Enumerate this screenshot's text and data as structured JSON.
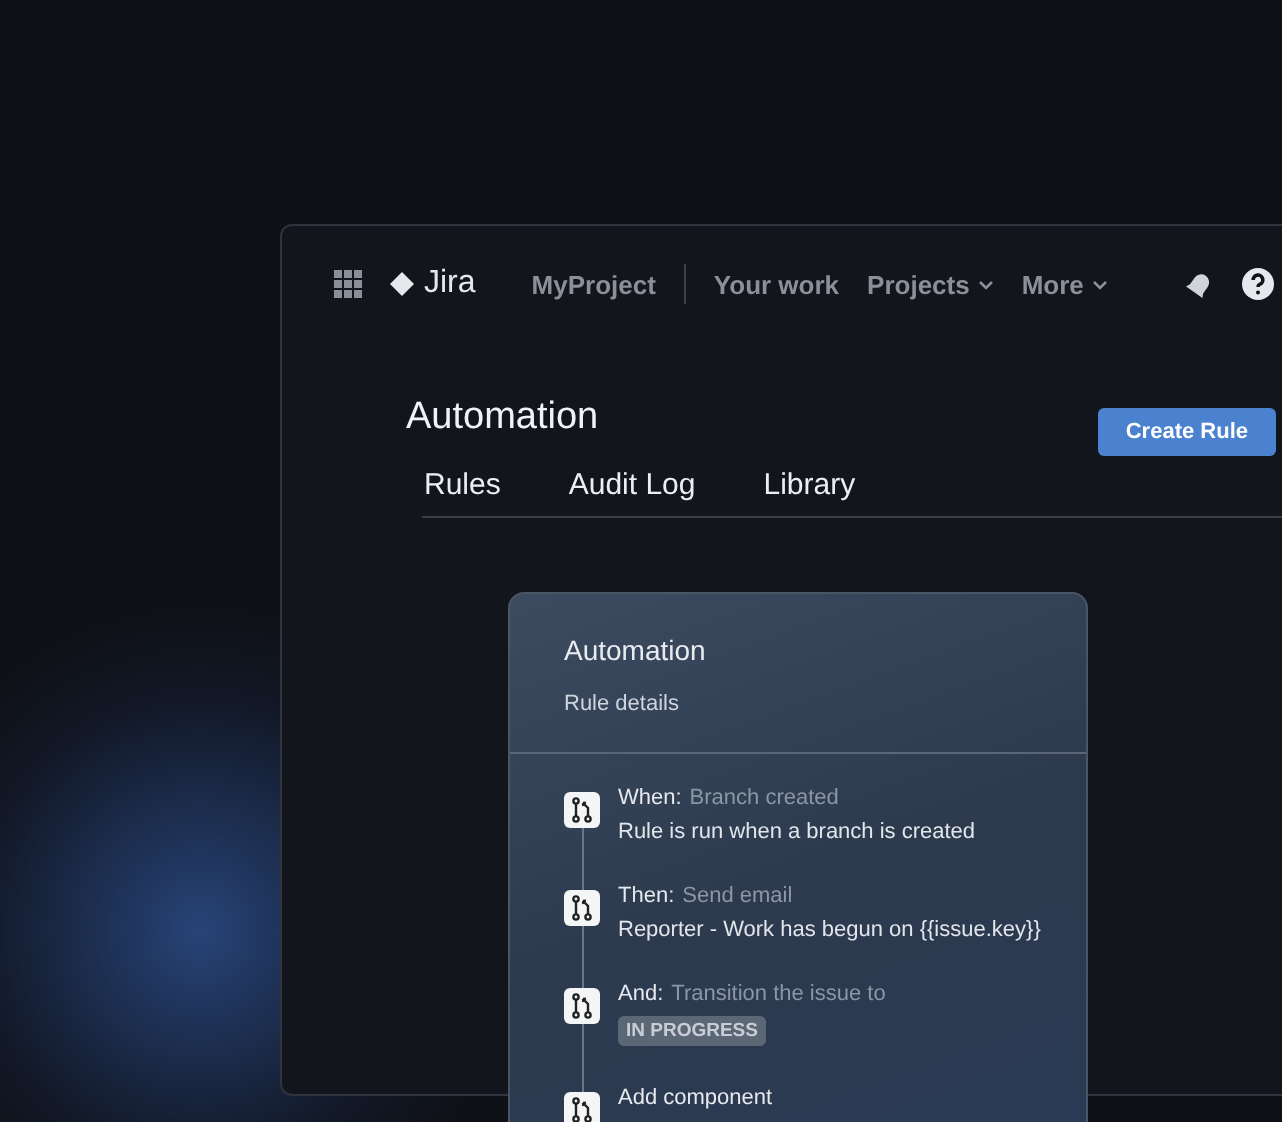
{
  "nav": {
    "logo": "Jira",
    "items": [
      {
        "label": "MyProject",
        "dropdown": false
      },
      {
        "label": "Your work",
        "dropdown": false
      },
      {
        "label": "Projects",
        "dropdown": true
      },
      {
        "label": "More",
        "dropdown": true
      }
    ]
  },
  "page": {
    "title": "Automation",
    "create_button": "Create Rule",
    "tabs": [
      "Rules",
      "Audit Log",
      "Library"
    ]
  },
  "card": {
    "title": "Automation",
    "subtitle": "Rule details",
    "steps": [
      {
        "prefix": "When:",
        "summary": "Branch created",
        "detail": "Rule is run when a branch is created"
      },
      {
        "prefix": "Then:",
        "summary": "Send email",
        "detail": "Reporter - Work has begun on {{issue.key}}"
      },
      {
        "prefix": "And:",
        "summary": "Transition the issue to",
        "badge": "IN PROGRESS"
      },
      {
        "prefix": "Add component"
      }
    ]
  }
}
